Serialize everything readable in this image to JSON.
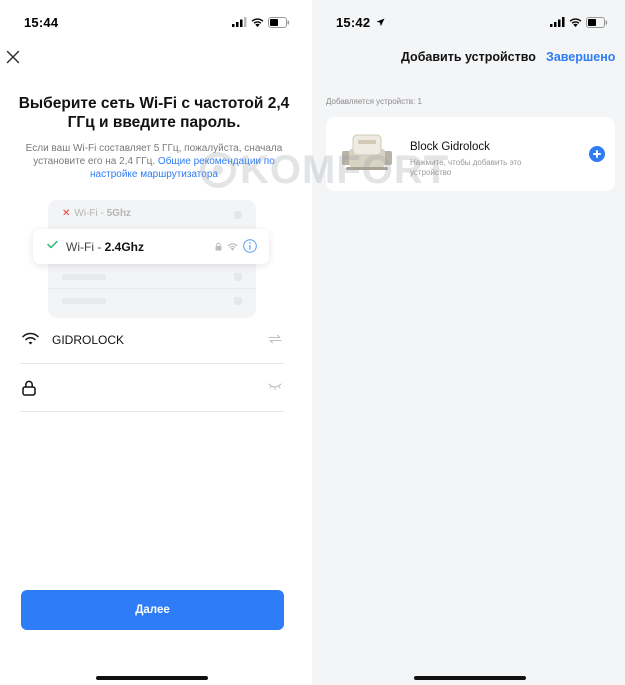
{
  "left": {
    "status": {
      "time": "15:44"
    },
    "title": "Выберите сеть Wi-Fi с частотой 2,4 ГГц и введите пароль.",
    "subtitle_text": "Если ваш Wi-Fi составляет 5 ГГц, пожалуйста, сначала установите его на 2,4 ГГц.",
    "subtitle_link": "Общие рекомендации по настройке маршрутизатора",
    "illustration": {
      "network_5g_prefix": "Wi-Fi - ",
      "network_5g_band": "5Ghz",
      "network_24g_prefix": "Wi-Fi - ",
      "network_24g_band": "2.4Ghz"
    },
    "ssid_value": "GIDROLOCK",
    "password_value": "",
    "next_button": "Далее"
  },
  "right": {
    "status": {
      "time": "15:42"
    },
    "nav_title": "Добавить устройство",
    "nav_done": "Завершено",
    "section_label": "Добавляется устройств: 1",
    "device": {
      "name": "Block Gidrolock",
      "hint": "Нажмите, чтобы добавить это устройство"
    }
  },
  "watermark": {
    "text": "KOMFORT"
  },
  "colors": {
    "accent": "#2e7cf6",
    "error": "#e53935",
    "success": "#2bb673"
  }
}
